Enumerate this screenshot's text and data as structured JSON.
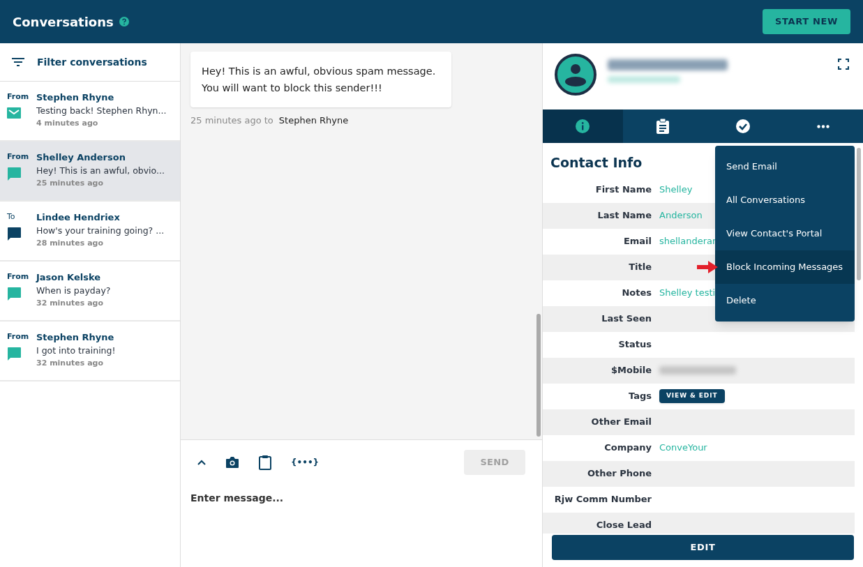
{
  "header": {
    "title": "Conversations",
    "start_button": "START NEW"
  },
  "filter": {
    "label": "Filter conversations"
  },
  "conversations": [
    {
      "direction": "From",
      "kind": "email",
      "color": "#26b5a0",
      "name": "Stephen Rhyne",
      "preview": "Testing back! Stephen Rhyn...",
      "time": "4 minutes ago",
      "selected": false
    },
    {
      "direction": "From",
      "kind": "sms",
      "color": "#26b5a0",
      "name": "Shelley Anderson",
      "preview": "Hey! This is an awful, obvio...",
      "time": "25 minutes ago",
      "selected": true
    },
    {
      "direction": "To",
      "kind": "sms",
      "color": "#0b4263",
      "name": "Lindee Hendriex",
      "preview": "How's your training going? ...",
      "time": "28 minutes ago",
      "selected": false
    },
    {
      "direction": "From",
      "kind": "sms",
      "color": "#26b5a0",
      "name": "Jason Kelske",
      "preview": "When is payday?",
      "time": "32 minutes ago",
      "selected": false
    },
    {
      "direction": "From",
      "kind": "sms",
      "color": "#26b5a0",
      "name": "Stephen Rhyne",
      "preview": "I got into training!",
      "time": "32 minutes ago",
      "selected": false
    }
  ],
  "message": {
    "text": "Hey! This is an awful, obvious spam message. You will want to block this sender!!!",
    "meta": "25 minutes ago to",
    "recipient": "Stephen Rhyne"
  },
  "composer": {
    "merge_fields": "{•••}",
    "send": "SEND",
    "send_disabled": true,
    "placeholder": "Enter message..."
  },
  "contact_tabs": [
    {
      "kind": "info",
      "selected": true
    },
    {
      "kind": "notes",
      "selected": false
    },
    {
      "kind": "tasks",
      "selected": false
    },
    {
      "kind": "more",
      "selected": false
    }
  ],
  "contact_info": {
    "title": "Contact Info",
    "fields": [
      {
        "label": "First Name",
        "value": "Shelley"
      },
      {
        "label": "Last Name",
        "value": "Anderson"
      },
      {
        "label": "Email",
        "value": "shellanderar"
      },
      {
        "label": "Title"
      },
      {
        "label": "Notes",
        "value": "Shelley testi"
      },
      {
        "label": "Last Seen"
      },
      {
        "label": "Status"
      },
      {
        "label": "$Mobile",
        "kind": "blurred"
      },
      {
        "label": "Tags",
        "kind": "button",
        "button": "VIEW & EDIT"
      },
      {
        "label": "Other Email"
      },
      {
        "label": "Company",
        "value": "ConveYour"
      },
      {
        "label": "Other Phone"
      },
      {
        "label": "Rjw Comm Number"
      },
      {
        "label": "Close Lead"
      }
    ],
    "edit_button": "EDIT"
  },
  "menu": [
    {
      "label": "Send Email",
      "selected": false
    },
    {
      "label": "All Conversations",
      "selected": false
    },
    {
      "label": "View Contact's Portal",
      "selected": false
    },
    {
      "label": "Block Incoming Messages",
      "selected": true
    },
    {
      "label": "Delete",
      "selected": false
    }
  ]
}
